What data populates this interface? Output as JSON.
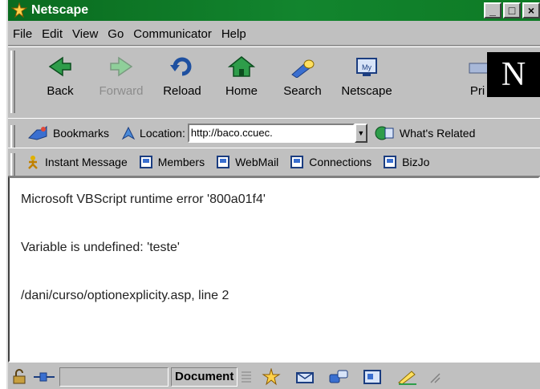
{
  "window": {
    "title": "Netscape",
    "buttons": [
      "_",
      "□",
      "×"
    ]
  },
  "menu": [
    "File",
    "Edit",
    "View",
    "Go",
    "Communicator",
    "Help"
  ],
  "toolbar": {
    "back": "Back",
    "forward": "Forward",
    "reload": "Reload",
    "home": "Home",
    "search": "Search",
    "netscape": "Netscape",
    "print": "Pri"
  },
  "locationbar": {
    "bookmarks": "Bookmarks",
    "location_label": "Location:",
    "url": "http://baco.ccuec.",
    "whats_related": "What's Related"
  },
  "personalbar": [
    "Instant Message",
    "Members",
    "WebMail",
    "Connections",
    "BizJo"
  ],
  "content": {
    "line1": "Microsoft VBScript runtime error '800a01f4'",
    "line2": "Variable is undefined: 'teste'",
    "line3": "/dani/curso/optionexplicity.asp, line 2"
  },
  "status": {
    "document": "Document"
  },
  "colors": {
    "titlebar": "#0e7a25",
    "chrome": "#c0c0c0"
  }
}
